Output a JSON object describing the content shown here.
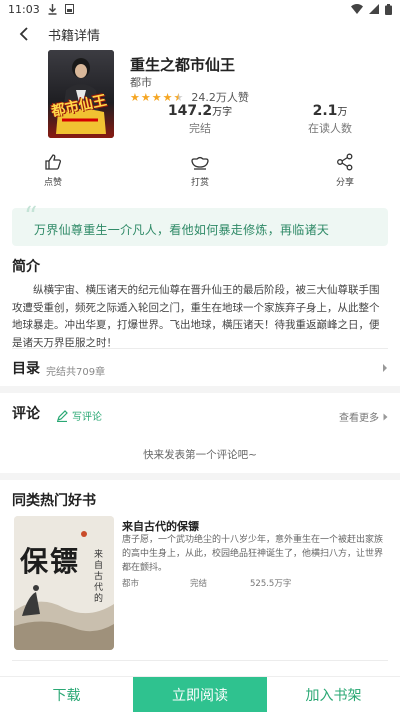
{
  "status": {
    "time": "11:03"
  },
  "nav": {
    "title": "书籍详情"
  },
  "book": {
    "title": "重生之都市仙王",
    "category": "都市",
    "rating": 4.5,
    "likes": "24.2万人赞",
    "word_count": "147.2",
    "word_unit": "万字",
    "status": "完结",
    "readers": "2.1",
    "readers_unit": "万",
    "readers_label": "在读人数",
    "cover_text": "都市仙王"
  },
  "actions": [
    {
      "label": "点赞",
      "icon": "thumbs-up-icon"
    },
    {
      "label": "打赏",
      "icon": "gold-ingot-icon"
    },
    {
      "label": "分享",
      "icon": "share-icon"
    }
  ],
  "quote": "万界仙尊重生一介凡人，看他如何暴走修炼，再临诸天",
  "intro": {
    "title": "简介",
    "text": "纵横宇宙、横压诸天的纪元仙尊在晋升仙王的最后阶段，被三大仙尊联手围攻遭受重创，频死之际遁入轮回之门，重生在地球一个家族弃子身上，从此整个地球暴走。冲出华夏，打爆世界。飞出地球，横压诸天！待我重返巅峰之日，便是诸天万界臣服之时！"
  },
  "toc": {
    "title": "目录",
    "subtitle": "完结共709章"
  },
  "comments": {
    "title": "评论",
    "write_label": "写评论",
    "more_label": "查看更多",
    "empty_text": "快来发表第一个评论吧~"
  },
  "similar": {
    "title": "同类热门好书",
    "items": [
      {
        "title": "来自古代的保镖",
        "description": "唐子愿，一个武功绝尘的十八岁少年，意外重生在一个被赶出家族的高中生身上，从此，校园绝品狂神诞生了，他横扫八方，让世界都在颤抖。",
        "category": "都市",
        "status": "完结",
        "words": "525.5万字",
        "cover_big": "保镖",
        "cover_side": "来自古代的"
      }
    ]
  },
  "bottom": {
    "download": "下载",
    "read_now": "立即阅读",
    "add_shelf": "加入书架"
  },
  "colors": {
    "accent": "#2fc28f",
    "accent_text": "#2aa874",
    "quote_bg": "#eef7f3",
    "star": "#f5a623"
  }
}
